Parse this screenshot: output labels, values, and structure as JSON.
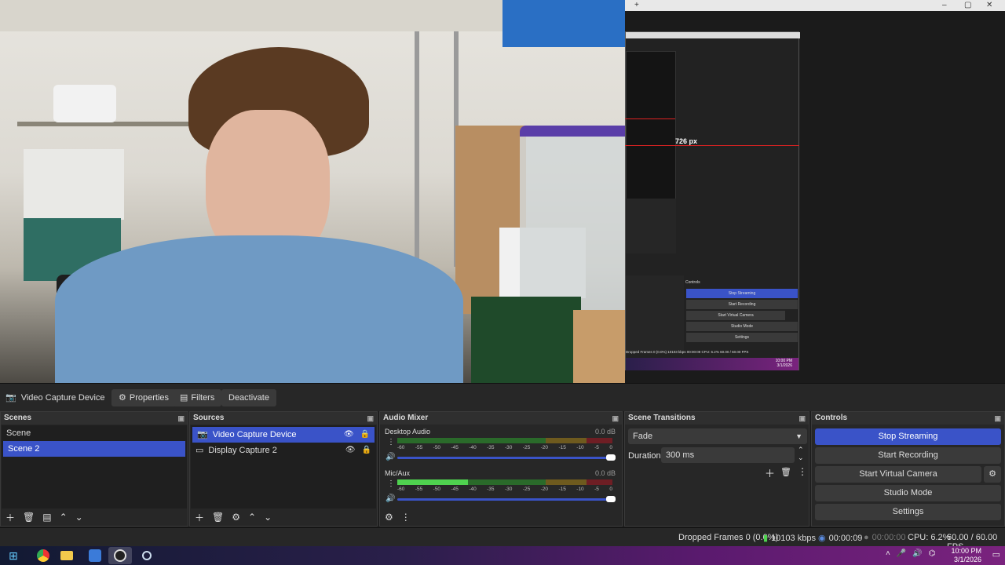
{
  "preview": {
    "px_label": "726 px",
    "inner": {
      "stop_streaming": "Stop Streaming",
      "start_recording": "Start Recording",
      "start_virtual_camera": "Start Virtual Camera",
      "studio_mode": "Studio Mode",
      "settings": "Settings",
      "controls_title": "Controls",
      "status": "Dropped Frames 0 (0.0%)   10103 kbps   00:00:09   CPU: 6.2%   60.00 / 60.00 FPS",
      "time": "10:00 PM",
      "date": "3/1/2026"
    }
  },
  "source_toolbar": {
    "source_name": "Video Capture Device",
    "properties": "Properties",
    "filters": "Filters",
    "deactivate": "Deactivate"
  },
  "scenes": {
    "title": "Scenes",
    "items": [
      {
        "label": "Scene",
        "selected": false
      },
      {
        "label": "Scene 2",
        "selected": true
      }
    ]
  },
  "sources": {
    "title": "Sources",
    "items": [
      {
        "label": "Video Capture Device",
        "selected": true
      },
      {
        "label": "Display Capture 2",
        "selected": false
      }
    ]
  },
  "audio_mixer": {
    "title": "Audio Mixer",
    "channels": [
      {
        "name": "Desktop Audio",
        "db": "0.0 dB",
        "level": 0.0,
        "volume": 1.0
      },
      {
        "name": "Mic/Aux",
        "db": "0.0 dB",
        "level": 0.33,
        "volume": 1.0
      }
    ],
    "ticks": [
      "-60",
      "-55",
      "-50",
      "-45",
      "-40",
      "-35",
      "-30",
      "-25",
      "-20",
      "-15",
      "-10",
      "-5",
      "0"
    ]
  },
  "scene_transitions": {
    "title": "Scene Transitions",
    "transition": "Fade",
    "duration_label": "Duration",
    "duration_value": "300 ms"
  },
  "controls": {
    "title": "Controls",
    "stop_streaming": "Stop Streaming",
    "start_recording": "Start Recording",
    "start_virtual_camera": "Start Virtual Camera",
    "studio_mode": "Studio Mode",
    "settings": "Settings"
  },
  "status_bar": {
    "dropped_frames": "Dropped Frames 0 (0.0%)",
    "bitrate": "10103 kbps",
    "stream_time": "00:00:09",
    "record_time": "00:00:00",
    "cpu": "CPU: 6.2%",
    "fps": "60.00 / 60.00 FPS"
  },
  "taskbar": {
    "time": "10:00 PM",
    "date": "3/1/2026"
  },
  "colors": {
    "accent": "#3a53c8",
    "panel": "#272727",
    "meter_green": "#4fd24f"
  }
}
